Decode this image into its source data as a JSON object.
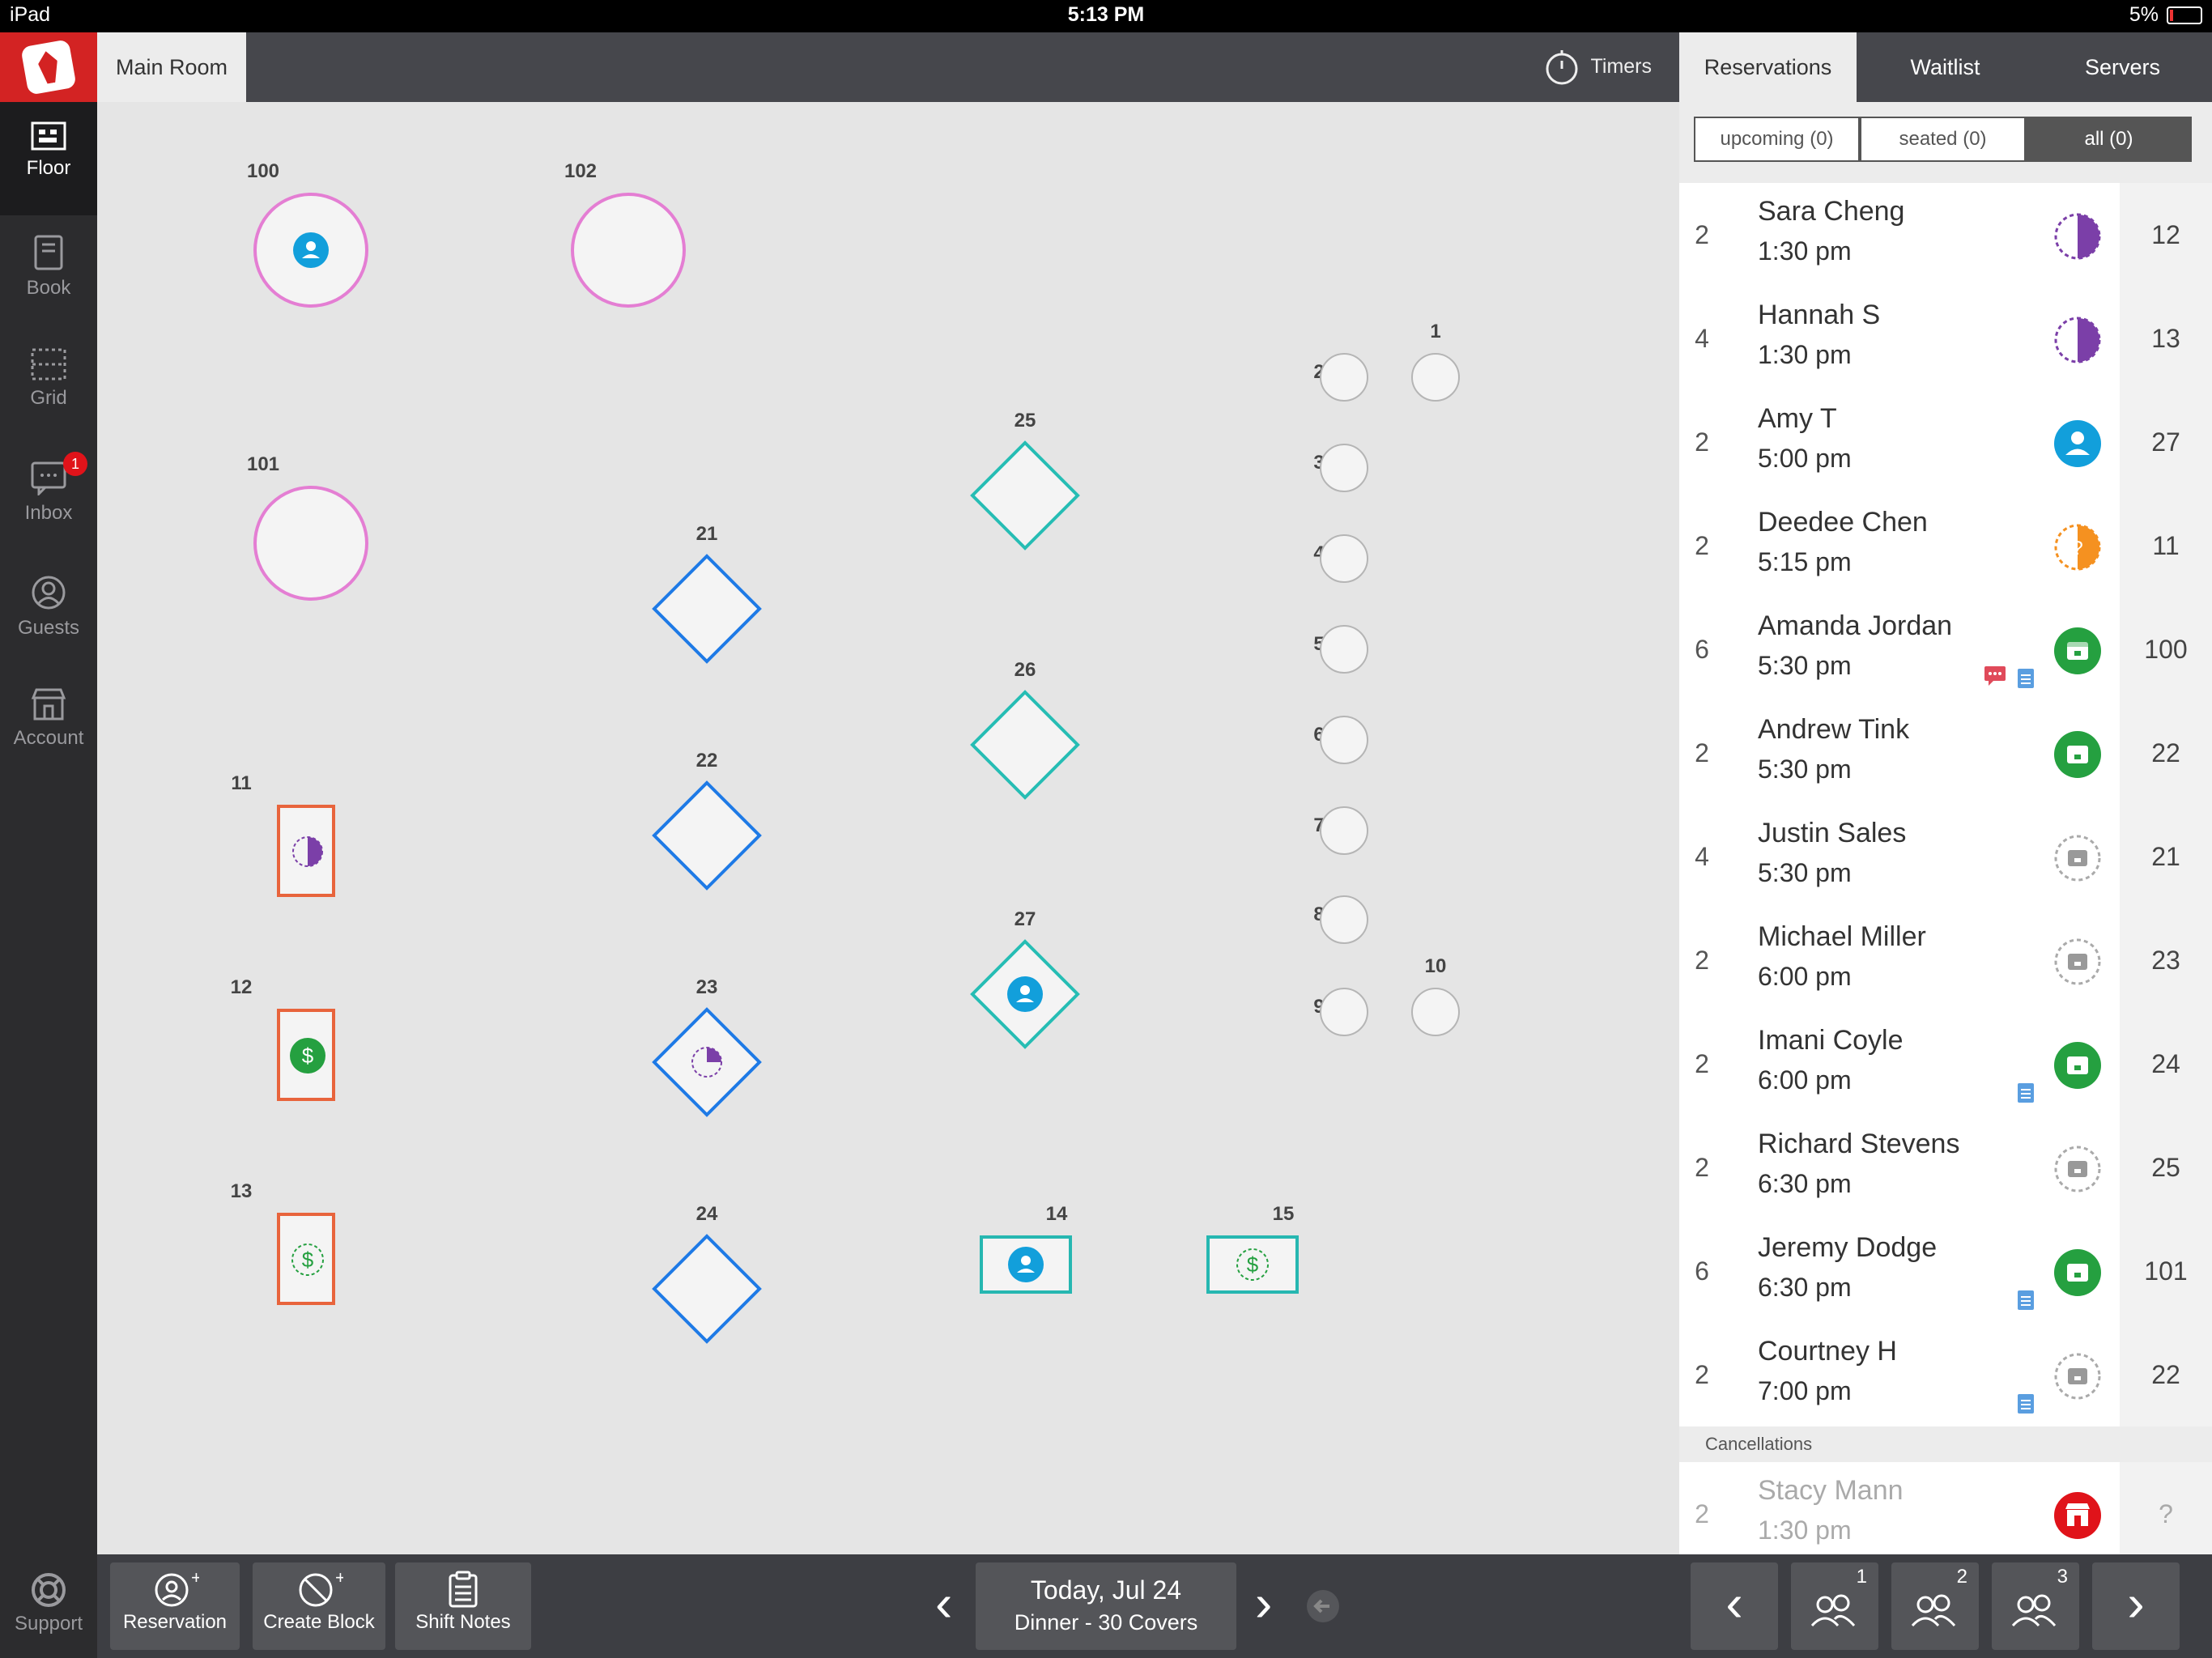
{
  "status_bar": {
    "device": "iPad",
    "time": "5:13 PM",
    "battery": "5%"
  },
  "sidebar": {
    "items": [
      {
        "label": "Floor",
        "icon": "floor-icon"
      },
      {
        "label": "Book",
        "icon": "book-icon"
      },
      {
        "label": "Grid",
        "icon": "grid-icon"
      },
      {
        "label": "Inbox",
        "icon": "inbox-icon",
        "badge": "1"
      },
      {
        "label": "Guests",
        "icon": "guests-icon"
      },
      {
        "label": "Account",
        "icon": "account-icon"
      }
    ],
    "support_label": "Support"
  },
  "topbar": {
    "room_tab": "Main Room",
    "timers_label": "Timers"
  },
  "floor": {
    "tables": {
      "t100": "100",
      "t102": "102",
      "t101": "101",
      "t11": "11",
      "t12": "12",
      "t13": "13",
      "t21": "21",
      "t22": "22",
      "t23": "23",
      "t24": "24",
      "t25": "25",
      "t26": "26",
      "t27": "27",
      "t14": "14",
      "t15": "15",
      "t1": "1",
      "t2": "2",
      "t3": "3",
      "t4": "4",
      "t5": "5",
      "t6": "6",
      "t7": "7",
      "t8": "8",
      "t9": "9",
      "t10": "10"
    }
  },
  "panel": {
    "tabs": [
      "Reservations",
      "Waitlist",
      "Servers"
    ],
    "filters": [
      "upcoming (0)",
      "seated (0)",
      "all (0)"
    ],
    "reservations": [
      {
        "size": "2",
        "name": "Sara Cheng",
        "time": "1:30 pm",
        "status": "half-moon",
        "table": "12"
      },
      {
        "size": "4",
        "name": "Hannah S",
        "time": "1:30 pm",
        "status": "half-moon",
        "table": "13"
      },
      {
        "size": "2",
        "name": "Amy T",
        "time": "5:00 pm",
        "status": "seated-person",
        "table": "27"
      },
      {
        "size": "2",
        "name": "Deedee Chen",
        "time": "5:15 pm",
        "status": "half-orange",
        "table": "11"
      },
      {
        "size": "6",
        "name": "Amanda Jordan",
        "time": "5:30 pm",
        "status": "confirmed",
        "table": "100"
      },
      {
        "size": "2",
        "name": "Andrew Tink",
        "time": "5:30 pm",
        "status": "confirmed",
        "table": "22"
      },
      {
        "size": "4",
        "name": "Justin Sales",
        "time": "5:30 pm",
        "status": "pending",
        "table": "21"
      },
      {
        "size": "2",
        "name": "Michael Miller",
        "time": "6:00 pm",
        "status": "pending",
        "table": "23"
      },
      {
        "size": "2",
        "name": "Imani Coyle",
        "time": "6:00 pm",
        "status": "confirmed",
        "table": "24"
      },
      {
        "size": "2",
        "name": "Richard Stevens",
        "time": "6:30 pm",
        "status": "pending",
        "table": "25"
      },
      {
        "size": "6",
        "name": "Jeremy Dodge",
        "time": "6:30 pm",
        "status": "confirmed",
        "table": "101"
      },
      {
        "size": "2",
        "name": "Courtney H",
        "time": "7:00 pm",
        "status": "pending",
        "table": "22"
      }
    ],
    "cancellations_header": "Cancellations",
    "cancellations": [
      {
        "size": "2",
        "name": "Stacy Mann",
        "time": "1:30 pm",
        "status": "cancelled",
        "table": "?"
      }
    ]
  },
  "bottom_bar": {
    "reservation_label": "Reservation",
    "create_block_label": "Create Block",
    "shift_notes_label": "Shift Notes",
    "date": "Today, Jul 24",
    "shift": "Dinner - 30 Covers",
    "server_group_1": "1",
    "server_group_2": "2",
    "server_group_3": "3"
  },
  "colors": {
    "accent_red": "#d32323",
    "confirmed_green": "#25a040",
    "seated_blue": "#129fdb",
    "half_purple": "#7b3fa8",
    "orange": "#f59120"
  }
}
